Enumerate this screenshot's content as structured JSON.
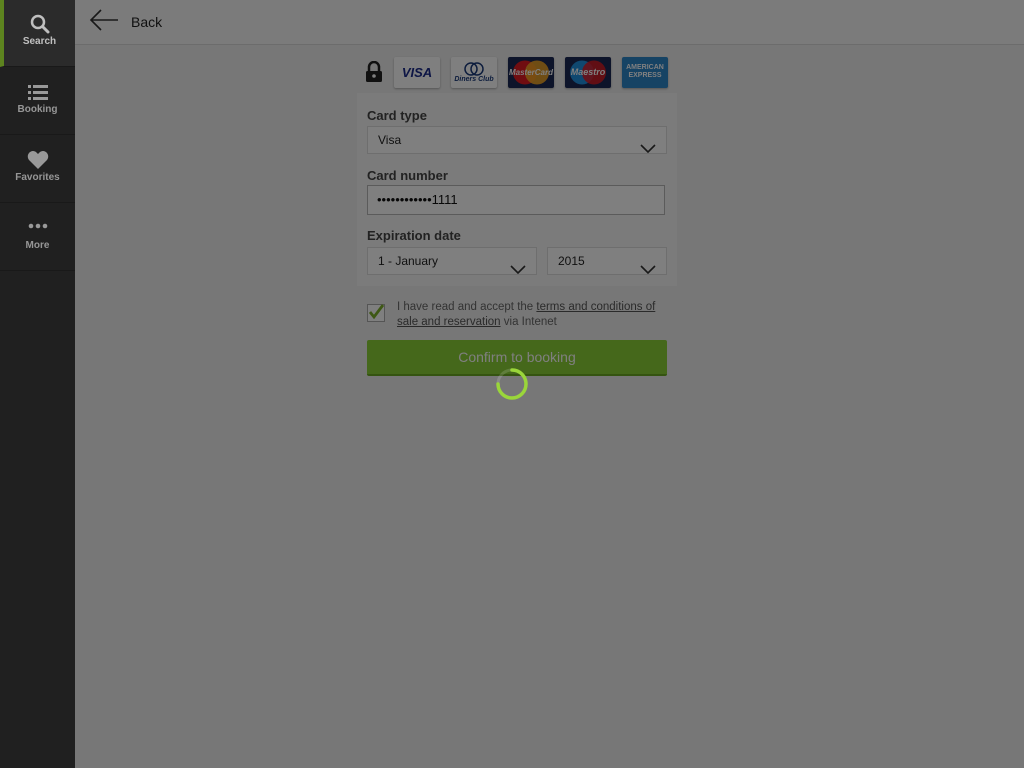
{
  "sidebar": {
    "items": [
      {
        "label": "Search",
        "icon": "search-icon"
      },
      {
        "label": "Booking",
        "icon": "list-icon"
      },
      {
        "label": "Favorites",
        "icon": "heart-icon"
      },
      {
        "label": "More",
        "icon": "more-dots-icon"
      }
    ],
    "active": "Search"
  },
  "header": {
    "back_label": "Back"
  },
  "payment": {
    "card_logos": [
      {
        "name": "VISA",
        "icon": "visa-logo"
      },
      {
        "name": "Diners Club",
        "icon": "diners-club-logo"
      },
      {
        "name": "MasterCard",
        "icon": "mastercard-logo"
      },
      {
        "name": "Maestro",
        "icon": "maestro-logo"
      },
      {
        "name": "AMERICAN EXPRESS",
        "icon": "amex-logo"
      }
    ],
    "card_type_label": "Card type",
    "card_type_value": "Visa",
    "card_number_label": "Card number",
    "card_number_value": "••••••••••••1111",
    "expiration_label": "Expiration date",
    "exp_month_value": "1 - January",
    "exp_year_value": "2015"
  },
  "terms": {
    "prefix": "I have read and accept the ",
    "link_text": "terms and conditions of sale and reservation",
    "suffix": " via Intenet",
    "checked": true
  },
  "confirm_label": "Confirm to booking",
  "colors": {
    "accent": "#7db02a",
    "button": "#8ad036",
    "sidebar": "#2b2b2b"
  },
  "loading": true
}
